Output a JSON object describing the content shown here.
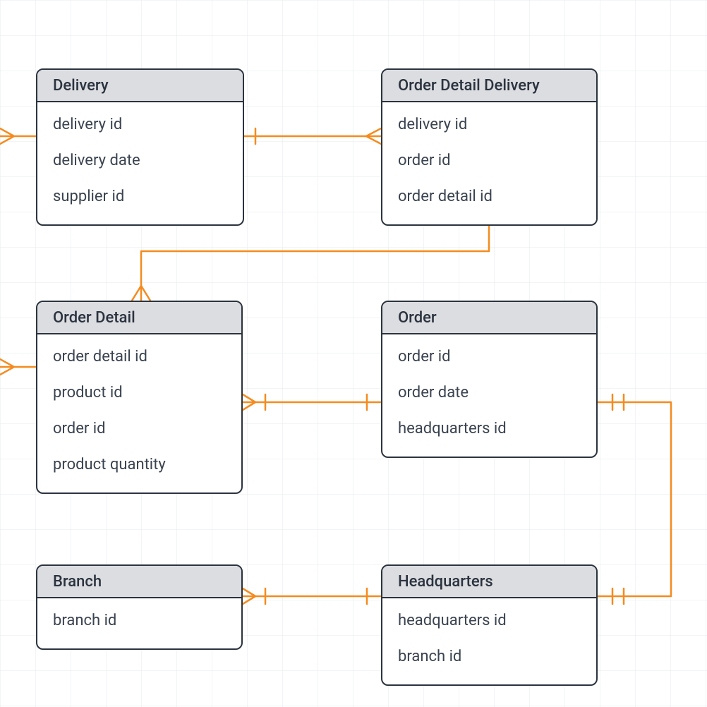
{
  "colors": {
    "connector": "#f58b1f",
    "entityBorder": "#2b333e",
    "entityHeaderBg": "#dbdde1"
  },
  "entities": {
    "delivery": {
      "title": "Delivery",
      "attrs": [
        "delivery id",
        "delivery date",
        "supplier id"
      ]
    },
    "orderDetailDelivery": {
      "title": "Order Detail Delivery",
      "attrs": [
        "delivery id",
        "order id",
        "order detail id"
      ]
    },
    "orderDetail": {
      "title": "Order Detail",
      "attrs": [
        "order detail id",
        "product id",
        "order id",
        "product quantity"
      ]
    },
    "order": {
      "title": "Order",
      "attrs": [
        "order id",
        "order date",
        "headquarters id"
      ]
    },
    "branch": {
      "title": "Branch",
      "attrs": [
        "branch id"
      ]
    },
    "headquarters": {
      "title": "Headquarters",
      "attrs": [
        "headquarters id",
        "branch id"
      ]
    }
  },
  "relationships": [
    {
      "from": "delivery",
      "to": "(offscreen-left)",
      "fromCard": "many",
      "toCard": ""
    },
    {
      "from": "delivery",
      "to": "orderDetailDelivery",
      "fromCard": "one",
      "toCard": "many"
    },
    {
      "from": "orderDetailDelivery",
      "to": "orderDetail",
      "fromCard": "one",
      "toCard": "many"
    },
    {
      "from": "orderDetail",
      "to": "(offscreen-left)",
      "fromCard": "many",
      "toCard": ""
    },
    {
      "from": "orderDetail",
      "to": "order",
      "fromCard": "many-one",
      "toCard": "one"
    },
    {
      "from": "order",
      "to": "headquarters",
      "fromCard": "one-one",
      "toCard": "one-one"
    },
    {
      "from": "branch",
      "to": "headquarters",
      "fromCard": "many-one",
      "toCard": "one"
    }
  ]
}
